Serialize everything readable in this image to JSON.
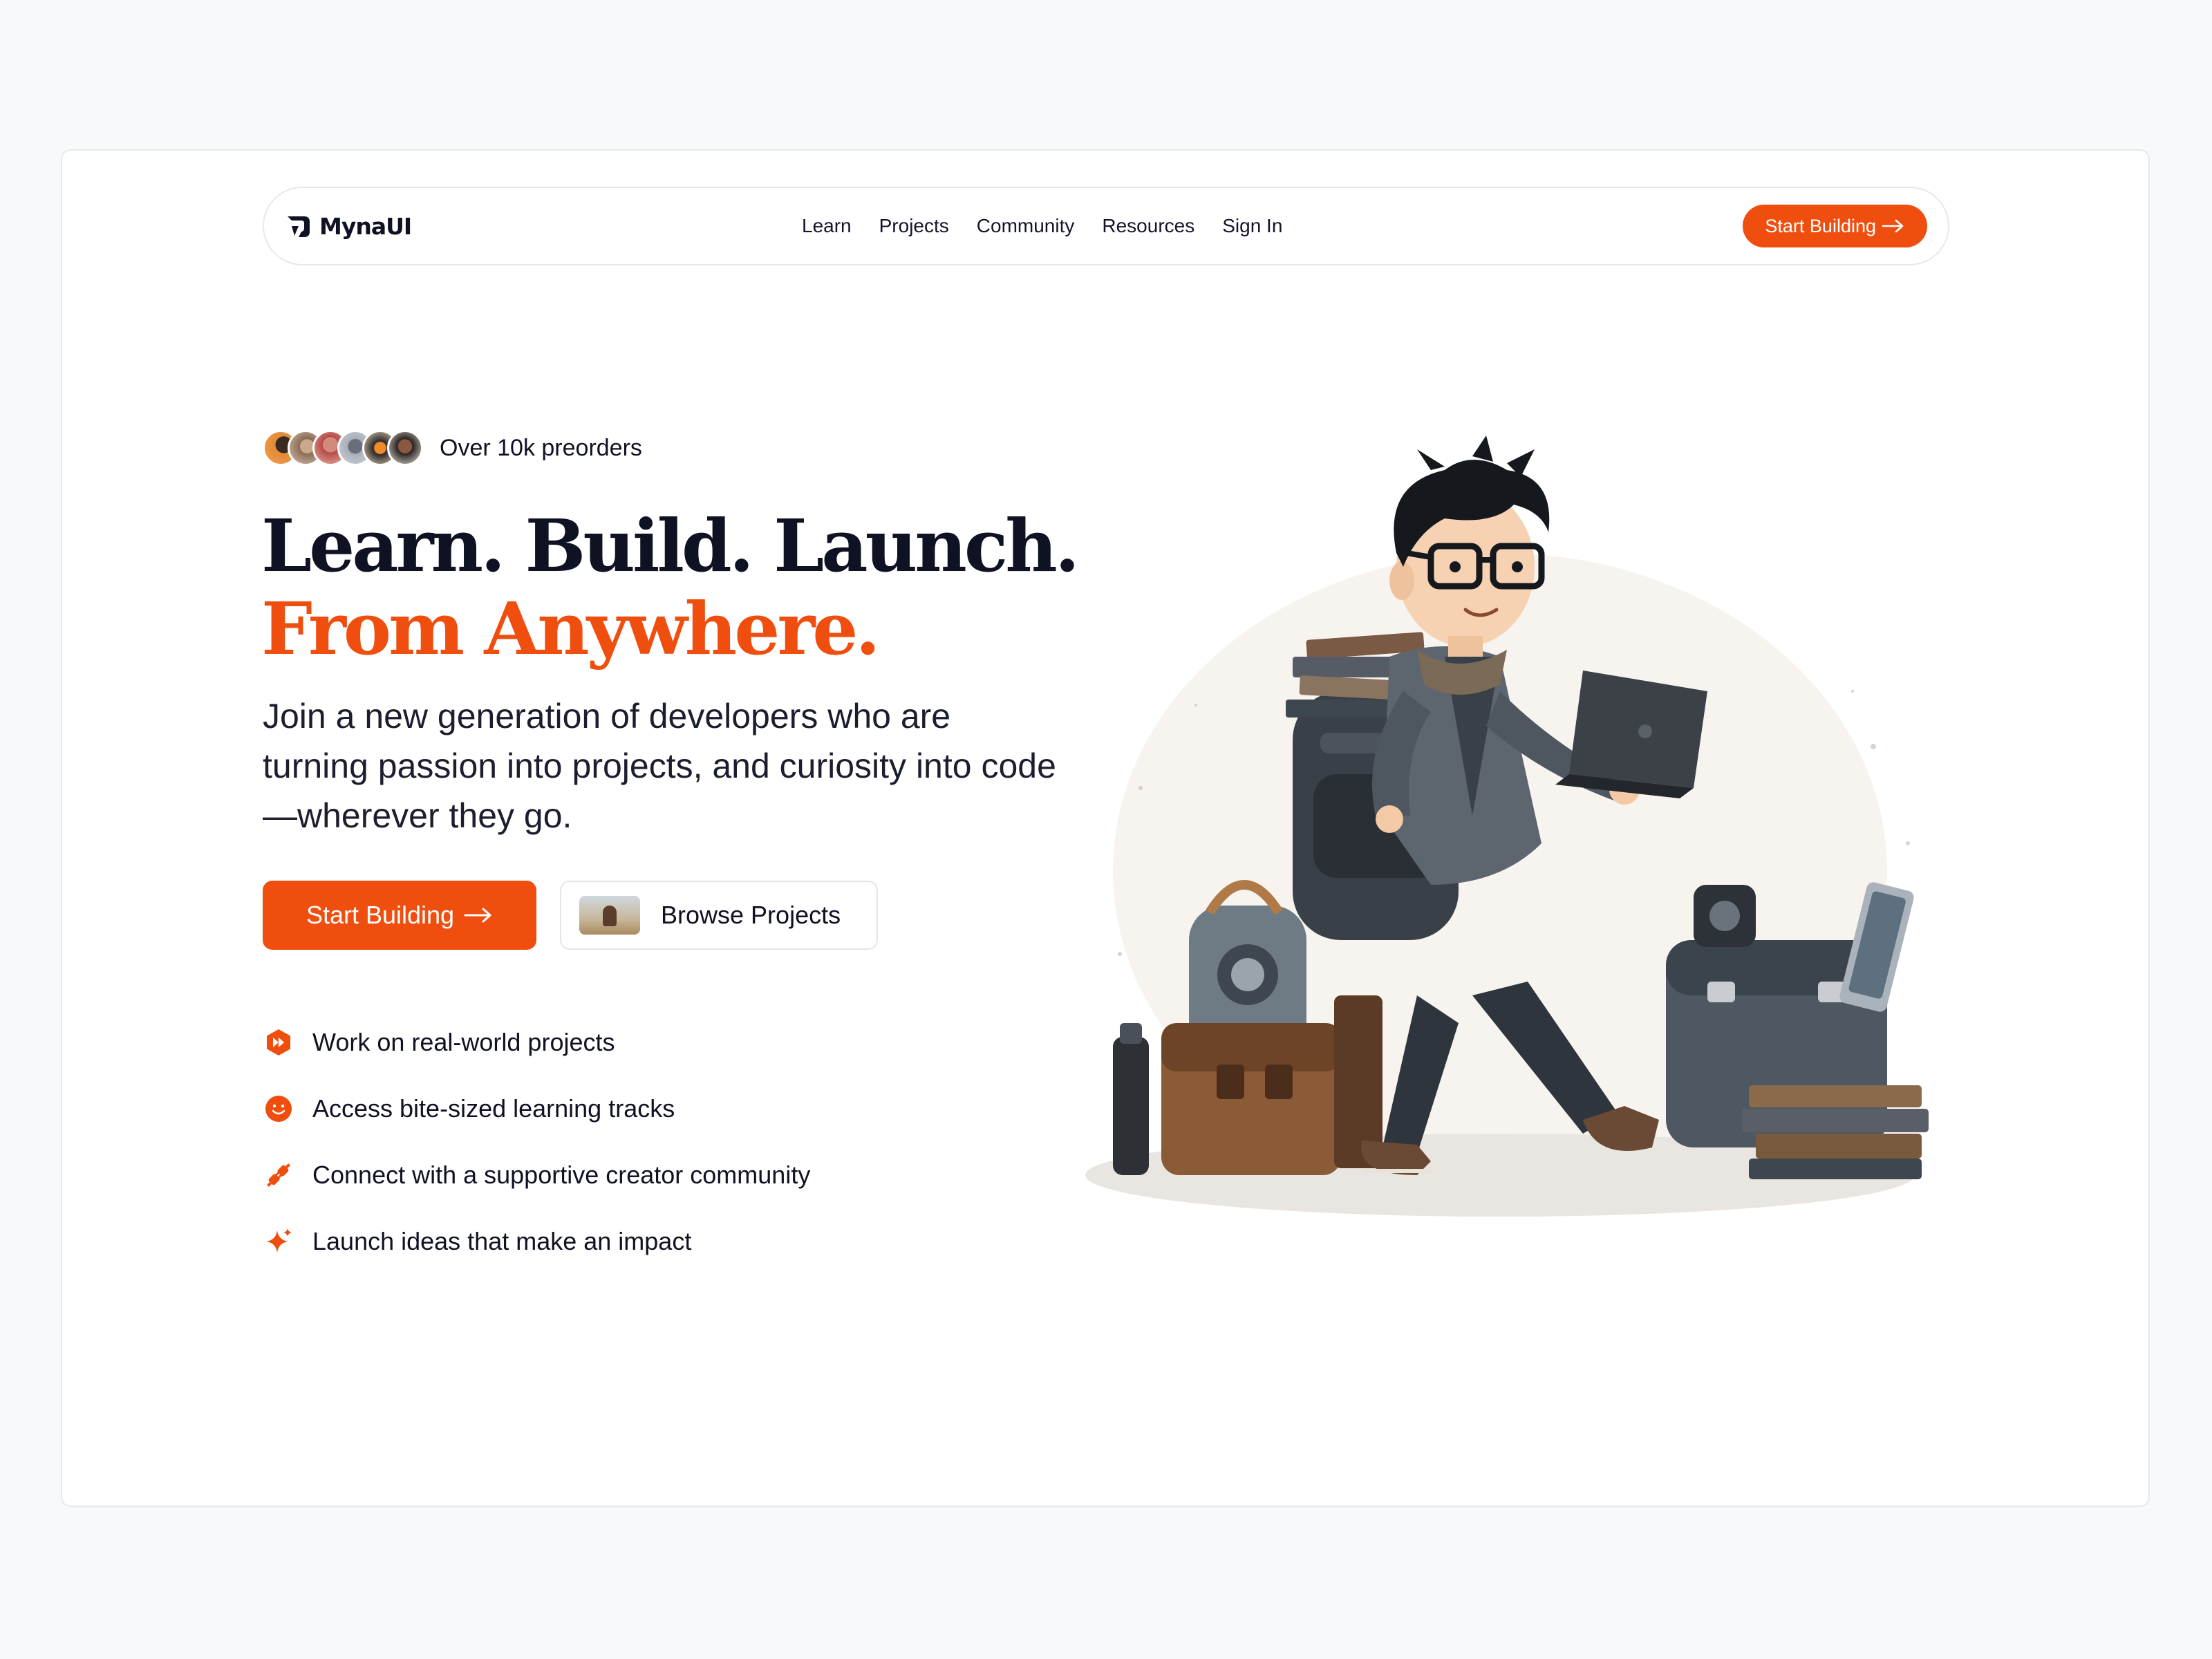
{
  "brand": {
    "name": "MynaUI",
    "accent_color": "#f04e0f",
    "logo_icon": "myna-logo-icon"
  },
  "nav": {
    "links": [
      "Learn",
      "Projects",
      "Community",
      "Resources",
      "Sign In"
    ],
    "cta_label": "Start Building",
    "cta_icon": "arrow-right-icon"
  },
  "hero": {
    "preorders_text": "Over 10k preorders",
    "avatar_count": 6,
    "headline_line1": "Learn. Build. Launch.",
    "headline_line2": "From Anywhere.",
    "subtext": "Join a new generation of developers who are turning passion into projects, and curiosity into code—wherever they go.",
    "primary_button": "Start Building",
    "secondary_button": "Browse Projects"
  },
  "features": [
    {
      "label": "Work on real-world projects",
      "icon": "fast-forward-hexagon-icon"
    },
    {
      "label": "Access bite-sized learning tracks",
      "icon": "smiley-icon"
    },
    {
      "label": "Connect with a supportive creator community",
      "icon": "plug-icon"
    },
    {
      "label": "Launch ideas that make an impact",
      "icon": "sparkles-icon"
    }
  ],
  "illustration": {
    "icon": "student-with-laptop-illustration"
  }
}
